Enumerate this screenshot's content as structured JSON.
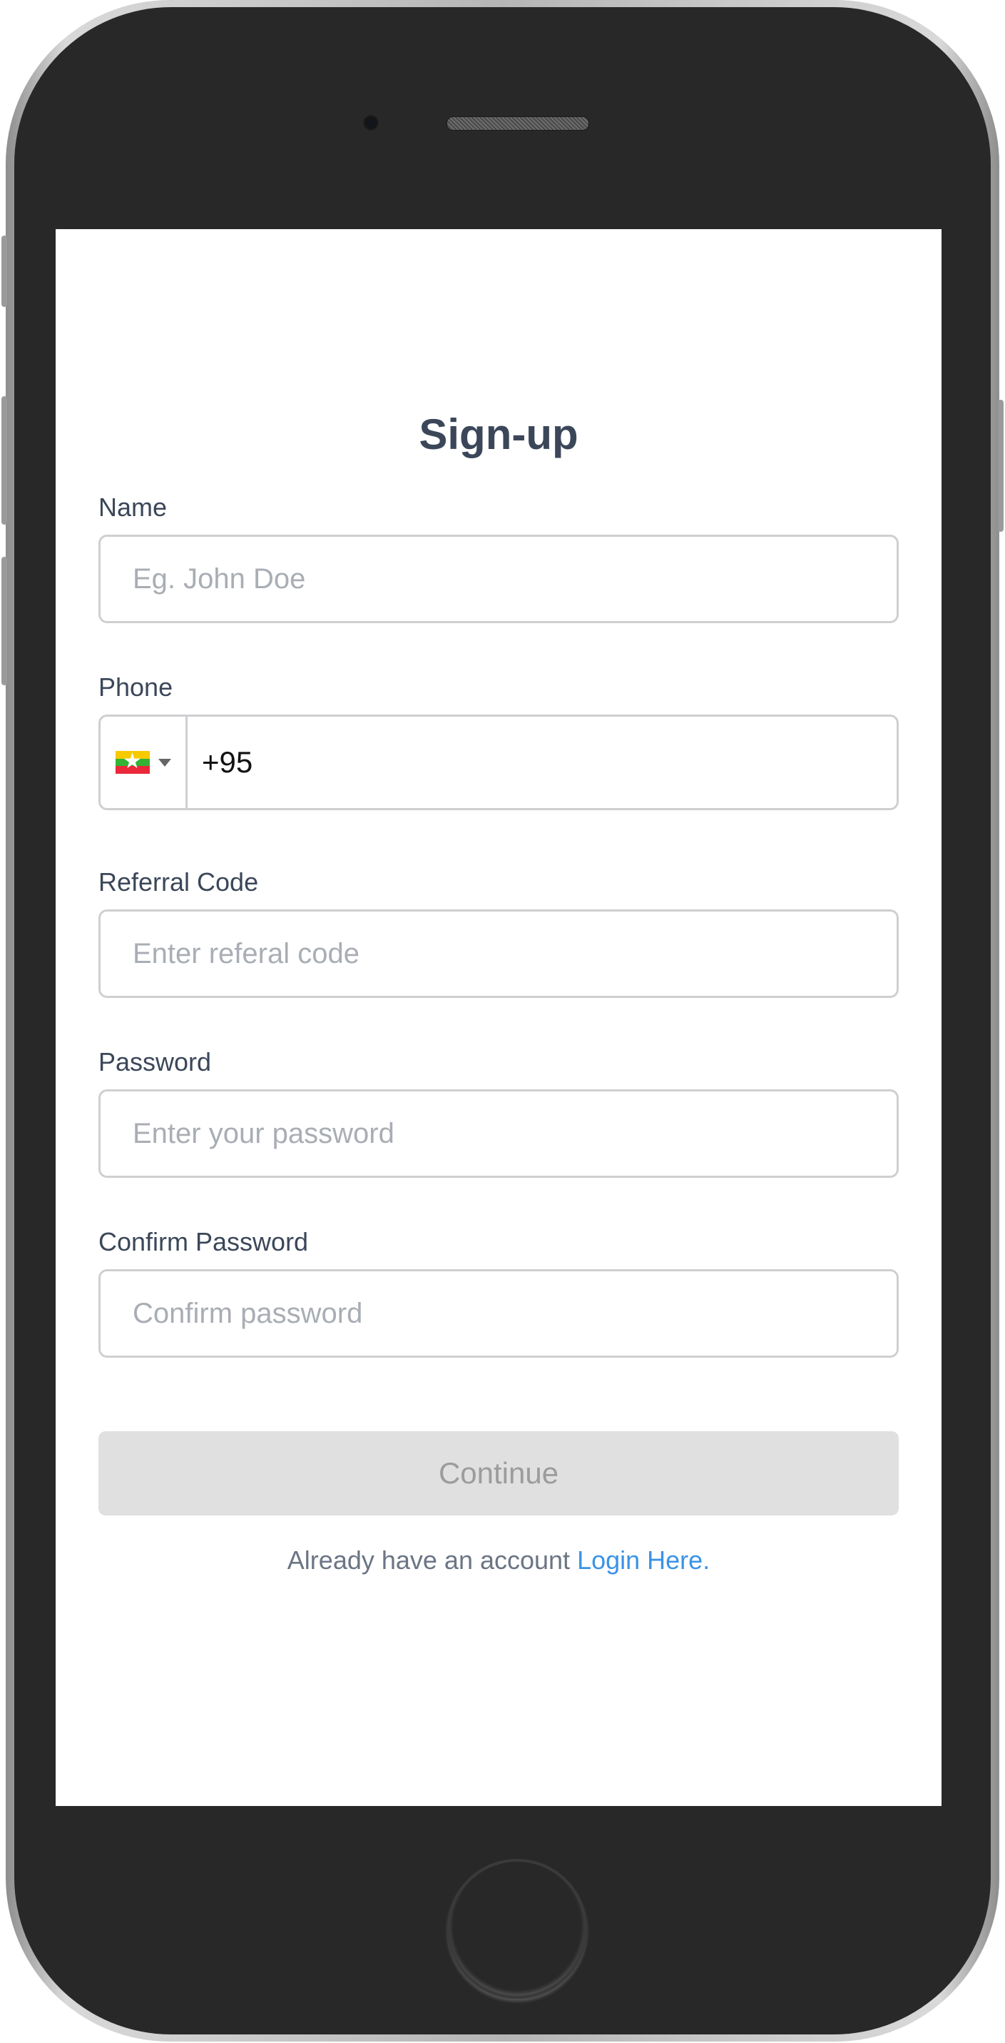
{
  "form": {
    "title": "Sign-up",
    "name": {
      "label": "Name",
      "placeholder": "Eg. John Doe",
      "value": ""
    },
    "phone": {
      "label": "Phone",
      "country_flag": "myanmar-flag-icon",
      "value": "+95"
    },
    "referral": {
      "label": "Referral Code",
      "placeholder": "Enter referal code",
      "value": ""
    },
    "password": {
      "label": "Password",
      "placeholder": "Enter your password",
      "value": ""
    },
    "confirm_password": {
      "label": "Confirm Password",
      "placeholder": "Confirm password",
      "value": ""
    },
    "continue_label": "Continue",
    "login_prompt": "Already have an account",
    "login_link": "Login Here."
  },
  "colors": {
    "heading": "#3b4759",
    "link": "#3a93e6",
    "button_disabled_bg": "#e0e0e0",
    "button_disabled_text": "#9c9c9c",
    "input_border": "#cfcfd2"
  }
}
